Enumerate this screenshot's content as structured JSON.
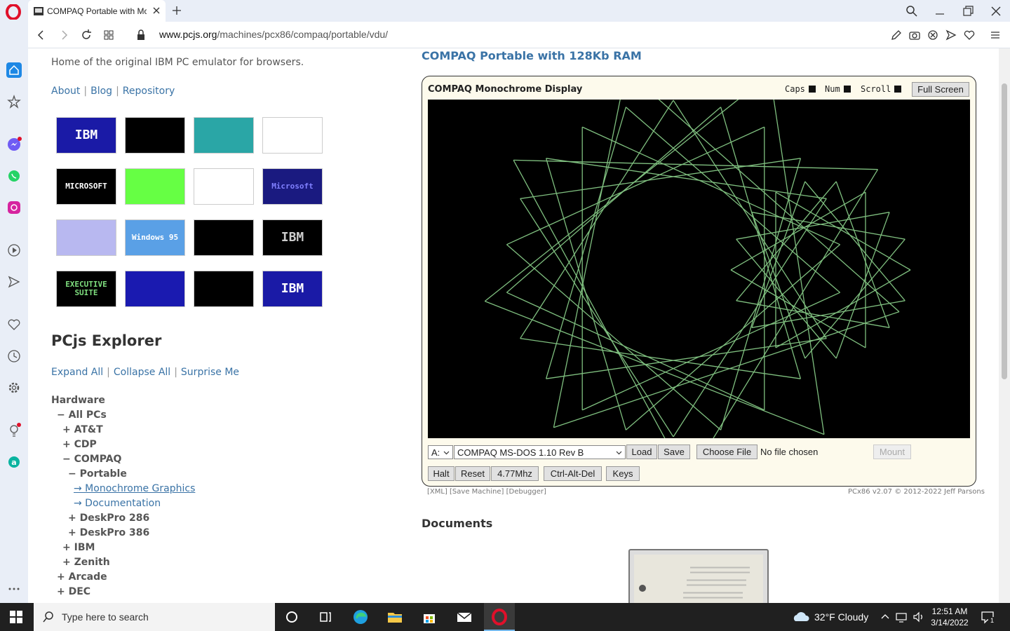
{
  "browser": {
    "tab_title": "COMPAQ Portable with Mc",
    "url_host": "www.pcjs.org",
    "url_path": "/machines/pcx86/compaq/portable/vdu/"
  },
  "left": {
    "tagline": "Home of the original IBM PC emulator for browsers.",
    "links": [
      "About",
      "Blog",
      "Repository"
    ],
    "thumbnails": [
      {
        "label": "IBM",
        "bg": "#1a1aa6",
        "fg": "#ffffff"
      },
      {
        "label": "",
        "bg": "#000000",
        "fg": "#7fcf7f"
      },
      {
        "label": "",
        "bg": "#2aa6a6",
        "fg": "#ffffff"
      },
      {
        "label": "",
        "bg": "#ffffff",
        "fg": "#333333"
      },
      {
        "label": "MICROSOFT",
        "bg": "#000000",
        "fg": "#ffffff"
      },
      {
        "label": "",
        "bg": "#66ff44",
        "fg": "#333333"
      },
      {
        "label": "",
        "bg": "#ffffff",
        "fg": "#0000aa"
      },
      {
        "label": "Microsoft",
        "bg": "#1a1a80",
        "fg": "#8080ff"
      },
      {
        "label": "",
        "bg": "#b8b8f0",
        "fg": "#000080"
      },
      {
        "label": "Windows 95",
        "bg": "#5aa0e6",
        "fg": "#ffffff"
      },
      {
        "label": "",
        "bg": "#000000",
        "fg": "#cccccc"
      },
      {
        "label": "IBM",
        "bg": "#000000",
        "fg": "#cccccc"
      },
      {
        "label": "EXECUTIVE SUITE",
        "bg": "#000000",
        "fg": "#7fdf7f"
      },
      {
        "label": "",
        "bg": "#1a1ab0",
        "fg": "#ffffff"
      },
      {
        "label": "",
        "bg": "#000000",
        "fg": "#7fdf7f"
      },
      {
        "label": "IBM",
        "bg": "#1a1aa6",
        "fg": "#ffffff"
      }
    ],
    "explorer_title": "PCjs Explorer",
    "explorer_links": [
      "Expand All",
      "Collapse All",
      "Surprise Me"
    ],
    "tree": [
      {
        "label": "Hardware",
        "indent": 0,
        "type": "head"
      },
      {
        "label": "− All PCs",
        "indent": 1,
        "type": "node"
      },
      {
        "label": "+ AT&T",
        "indent": 2,
        "type": "node"
      },
      {
        "label": "+ CDP",
        "indent": 2,
        "type": "node"
      },
      {
        "label": "− COMPAQ",
        "indent": 2,
        "type": "node"
      },
      {
        "label": "− Portable",
        "indent": 3,
        "type": "node"
      },
      {
        "label": "→ Monochrome Graphics",
        "indent": 4,
        "type": "link-ul"
      },
      {
        "label": "→ Documentation",
        "indent": 4,
        "type": "link"
      },
      {
        "label": "+ DeskPro 286",
        "indent": 3,
        "type": "node"
      },
      {
        "label": "+ DeskPro 386",
        "indent": 3,
        "type": "node"
      },
      {
        "label": "+ IBM",
        "indent": 2,
        "type": "node"
      },
      {
        "label": "+ Zenith",
        "indent": 2,
        "type": "node"
      },
      {
        "label": "+ Arcade",
        "indent": 1,
        "type": "node"
      },
      {
        "label": "+ DEC",
        "indent": 1,
        "type": "node"
      }
    ]
  },
  "machine": {
    "title": "COMPAQ Portable with 128Kb RAM",
    "display_title": "COMPAQ Monochrome Display",
    "leds": [
      "Caps",
      "Num",
      "Scroll"
    ],
    "fullscreen": "Full Screen",
    "drive": "A:",
    "disk": "COMPAQ MS-DOS 1.10 Rev B",
    "load": "Load",
    "save": "Save",
    "choose_file": "Choose File",
    "no_file": "No file chosen",
    "mount": "Mount",
    "halt": "Halt",
    "reset": "Reset",
    "speed": "4.77Mhz",
    "cad": "Ctrl-Alt-Del",
    "keys": "Keys",
    "footer_links": "[XML]   [Save Machine]   [Debugger]",
    "copyright": "PCx86 v2.07 © 2012-2022 Jeff Parsons",
    "screen_color": "#7fbf7f"
  },
  "documents_title": "Documents",
  "taskbar": {
    "search_placeholder": "Type here to search",
    "weather": "32°F  Cloudy",
    "time": "12:51 AM",
    "date": "3/14/2022",
    "notif_count": "1"
  }
}
